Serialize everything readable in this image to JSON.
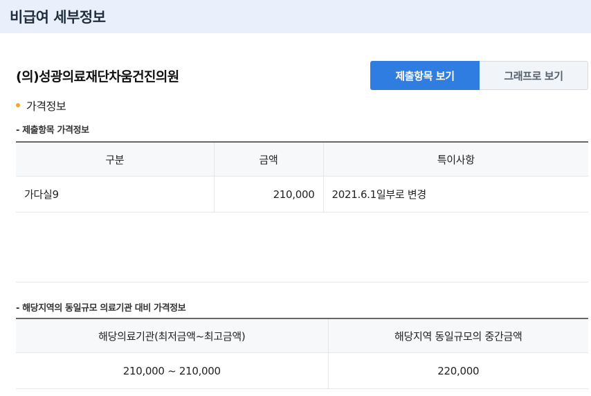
{
  "header": {
    "title": "비급여 세부정보"
  },
  "hospital": {
    "name": "(의)성광의료재단차움건진의원"
  },
  "buttons": {
    "submitted_view": "제출항목 보기",
    "graph_view": "그래프로 보기"
  },
  "section": {
    "title": "가격정보"
  },
  "submitted": {
    "subtitle": "- 제출항목 가격정보",
    "headers": [
      "구분",
      "금액",
      "특이사항"
    ],
    "rows": [
      {
        "category": "가다실9",
        "amount": "210,000",
        "note": "2021.6.1일부로 변경"
      }
    ]
  },
  "regional": {
    "subtitle": "- 해당지역의 동일규모 의료기관 대비 가격정보",
    "headers": [
      "해당의료기관(최저금액~최고금액)",
      "해당지역 동일규모의 중간금액"
    ],
    "rows": [
      {
        "range": "210,000 ~ 210,000",
        "median": "220,000"
      }
    ]
  }
}
